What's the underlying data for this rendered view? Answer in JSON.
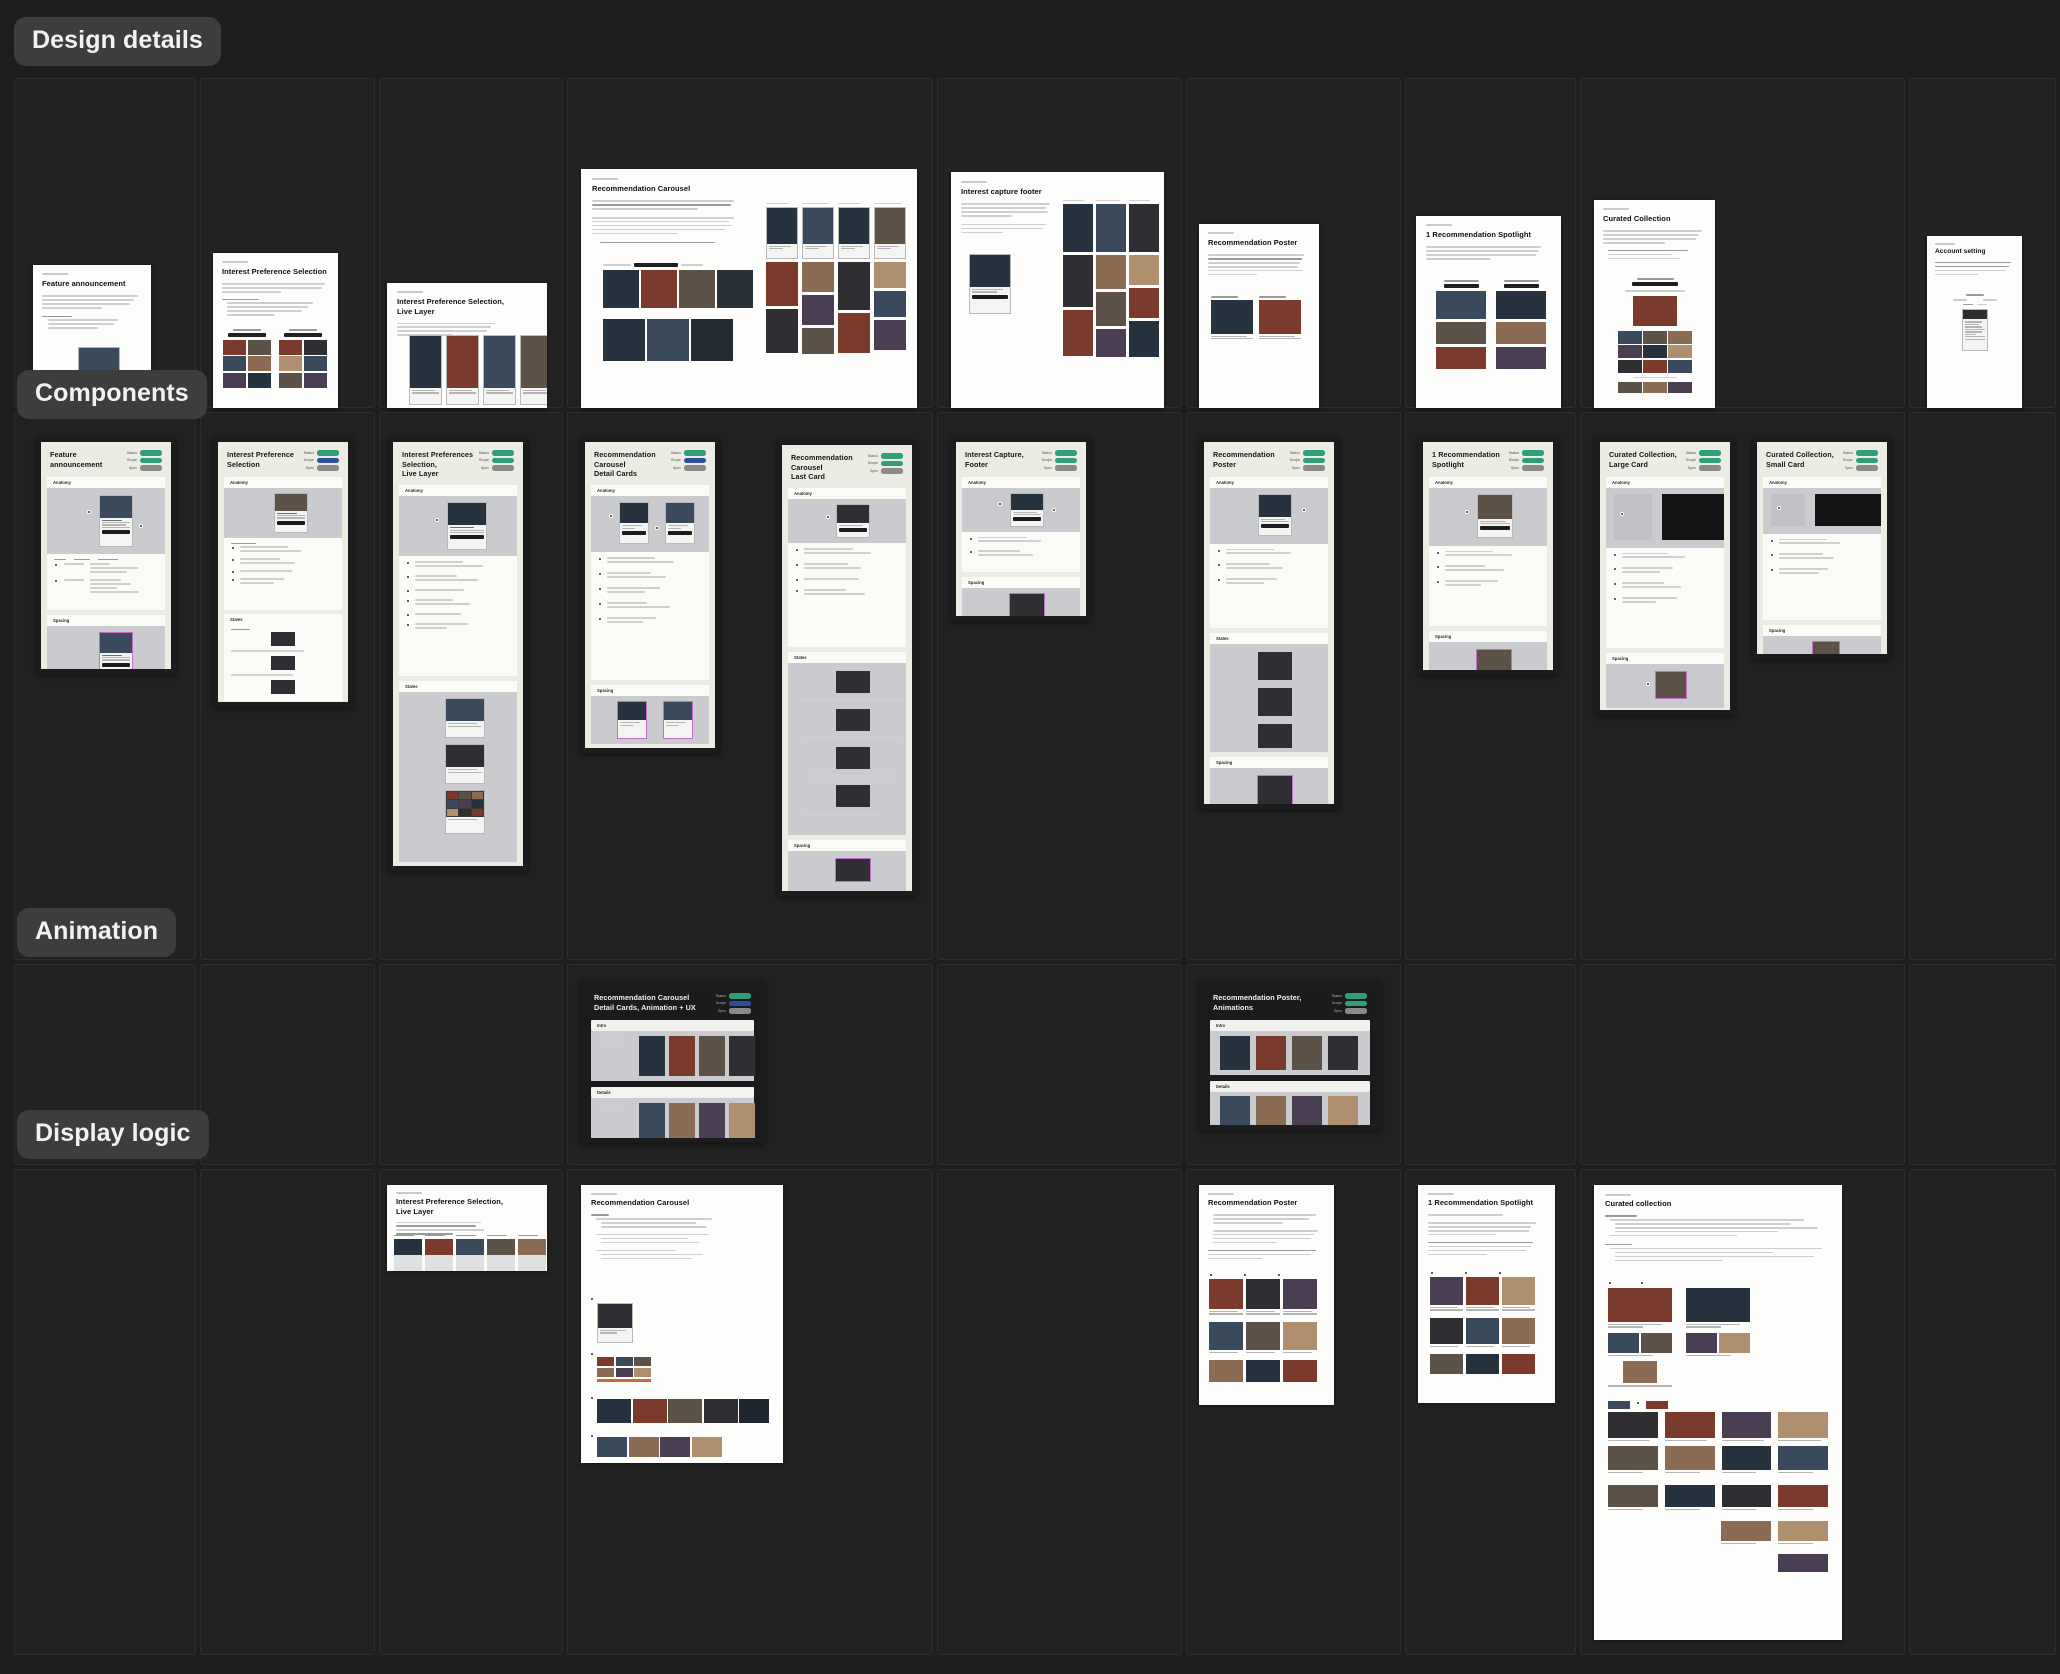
{
  "canvas": {
    "background": "#1e1e1e",
    "frame_fill": "#222222",
    "pill_fill": "#3d3d3d",
    "accent_green": "#2f9e79",
    "accent_blue": "#2f4d9e",
    "accent_gray": "#8a8a8a",
    "paper_fill": "#fdfdfb",
    "spec_fill": "#edece4"
  },
  "sections": [
    {
      "id": "design-details",
      "label": "Design details"
    },
    {
      "id": "components",
      "label": "Components"
    },
    {
      "id": "animation",
      "label": "Animation"
    },
    {
      "id": "display-logic",
      "label": "Display logic"
    }
  ],
  "badge_labels": {
    "status_key": "Status",
    "scope_key": "Scope",
    "spec_key": "Spec"
  },
  "bands": {
    "anatomy": "Anatomy",
    "spacing": "Spacing",
    "states": "States",
    "intro": "Intro",
    "details": "Details"
  },
  "rows": {
    "design_details": {
      "label": "Design details",
      "cards": [
        {
          "eyebrow": "Design Spec",
          "title": "Feature announcement"
        },
        {
          "eyebrow": "Design Spec",
          "title": "Interest Preference Selection"
        },
        {
          "eyebrow": "Design Spec",
          "title": "Interest Preference Selection,\nLive Layer"
        },
        {
          "eyebrow": "Design Spec",
          "title": "Recommendation Carousel"
        },
        {
          "eyebrow": "Design Spec",
          "title": "Interest capture footer"
        },
        {
          "eyebrow": "Design Spec",
          "title": "Recommendation Poster"
        },
        {
          "eyebrow": "Design Spec",
          "title": "1 Recommendation Spotlight"
        },
        {
          "eyebrow": "Design Spec",
          "title": "Curated Collection"
        },
        {
          "eyebrow": "Design Spec",
          "title": "Account setting"
        }
      ]
    },
    "components": {
      "label": "Components",
      "cards": [
        {
          "title": "Feature announcement",
          "badges": [
            "green",
            "green",
            "gray"
          ]
        },
        {
          "title": "Interest Preference Selection",
          "badges": [
            "green",
            "blue",
            "gray"
          ]
        },
        {
          "title": "Interest Preferences Selection,\nLive Layer",
          "badges": [
            "green",
            "green",
            "gray"
          ]
        },
        {
          "title": "Recommendation Carousel\nDetail Cards",
          "badges": [
            "green",
            "blue",
            "gray"
          ]
        },
        {
          "title": "Recommendation Carousel\nLast Card",
          "badges": [
            "green",
            "green",
            "gray"
          ]
        },
        {
          "title": "Interest Capture, Footer",
          "badges": [
            "green",
            "green",
            "gray"
          ]
        },
        {
          "title": "Recommendation Poster",
          "badges": [
            "green",
            "green",
            "gray"
          ]
        },
        {
          "title": "1 Recommendation Spotlight",
          "badges": [
            "green",
            "green",
            "gray"
          ]
        },
        {
          "title": "Curated Collection, Large Card",
          "badges": [
            "green",
            "green",
            "gray"
          ]
        },
        {
          "title": "Curated Collection, Small Card",
          "badges": [
            "green",
            "green",
            "gray"
          ]
        }
      ]
    },
    "animation": {
      "label": "Animation",
      "cards": [
        {
          "title": "Recommendation Carousel\nDetail Cards, Animation + UX",
          "badges": [
            "green",
            "blue",
            "gray"
          ]
        },
        {
          "title": "Recommendation Poster,\nAnimations",
          "badges": [
            "green",
            "green",
            "gray"
          ]
        }
      ]
    },
    "display_logic": {
      "label": "Display logic",
      "cards": [
        {
          "eyebrow": "Display logic",
          "title": "Interest Preference Selection,\nLive Layer"
        },
        {
          "eyebrow": "Display logic",
          "title": "Recommendation Carousel"
        },
        {
          "eyebrow": "Display logic",
          "title": "Recommendation Poster"
        },
        {
          "eyebrow": "Display logic",
          "title": "1 Recommendation Spotlight"
        },
        {
          "eyebrow": "Display logic",
          "title": "Curated collection"
        }
      ]
    }
  }
}
